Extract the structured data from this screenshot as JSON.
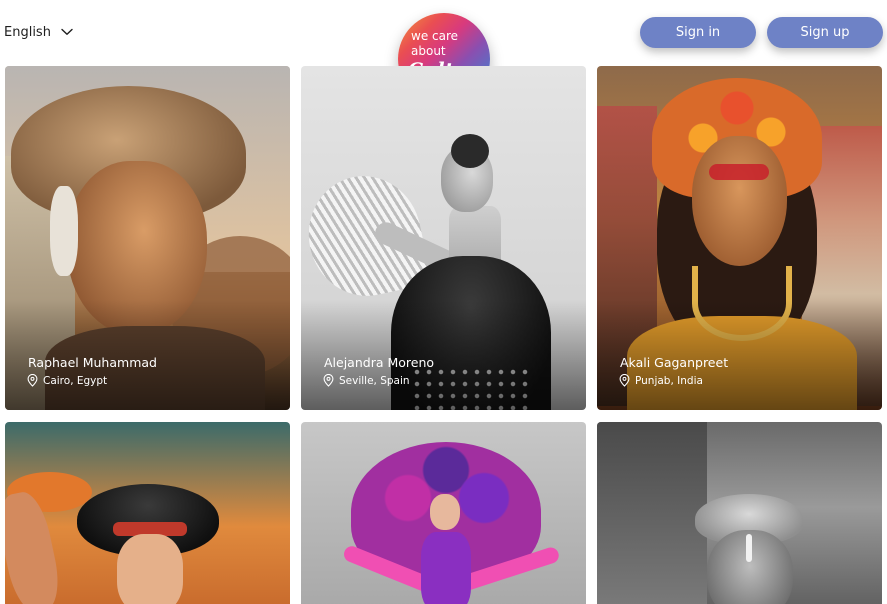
{
  "header": {
    "language": "English",
    "logo": {
      "line1": "we care",
      "line2": "about",
      "line3": "Culture"
    },
    "sign_in_label": "Sign in",
    "sign_up_label": "Sign up"
  },
  "colors": {
    "button": "#6e82c6",
    "button_text": "#ffffff",
    "background": "#ffffff",
    "text": "#1e1e1e"
  },
  "cards": [
    {
      "name": "Raphael Muhammad",
      "location": "Cairo, Egypt"
    },
    {
      "name": "Alejandra Moreno",
      "location": "Seville, Spain"
    },
    {
      "name": "Akali Gaganpreet",
      "location": "Punjab, India"
    },
    {
      "name": "",
      "location": ""
    },
    {
      "name": "",
      "location": ""
    },
    {
      "name": "",
      "location": ""
    }
  ],
  "icons": {
    "language_dropdown": "chevron-down-icon",
    "location": "map-pin-icon"
  }
}
